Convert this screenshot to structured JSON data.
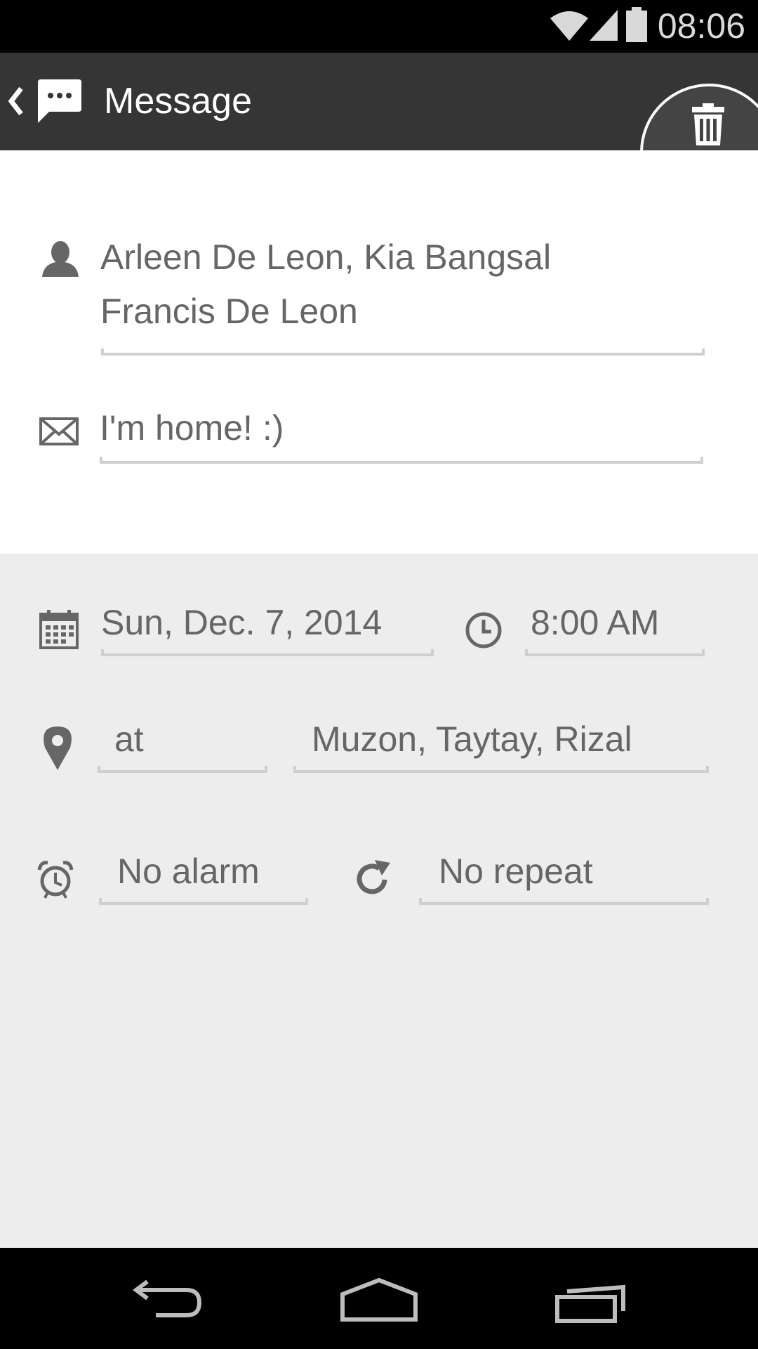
{
  "status_bar": {
    "time": "08:06",
    "icons": [
      "wifi-icon",
      "signal-icon",
      "battery-icon"
    ]
  },
  "action_bar": {
    "back_icon": "chevron-left-icon",
    "app_icon": "message-bubble-icon",
    "title": "Message",
    "delete_icon": "trash-icon"
  },
  "form": {
    "recipients": {
      "icon": "person-icon",
      "line1": "Arleen De Leon, Kia Bangsal",
      "line2": "Francis De Leon"
    },
    "message": {
      "icon": "envelope-icon",
      "value": "I'm home! :)"
    }
  },
  "schedule": {
    "date": {
      "icon": "calendar-icon",
      "value": "Sun, Dec. 7, 2014"
    },
    "time": {
      "icon": "clock-icon",
      "value": "8:00 AM"
    },
    "location": {
      "icon": "map-pin-icon",
      "prefix": "at",
      "value": "Muzon, Taytay, Rizal"
    },
    "alarm": {
      "icon": "alarm-clock-icon",
      "value": "No alarm"
    },
    "repeat": {
      "icon": "repeat-icon",
      "value": "No repeat"
    }
  },
  "nav_bar": {
    "icons": [
      "back-icon",
      "home-icon",
      "recents-icon"
    ]
  },
  "colors": {
    "action_bar": "#353535",
    "form_background": "#ffffff",
    "schedule_background": "#ededed",
    "text": "#666666",
    "underline": "#cfcfcf"
  }
}
